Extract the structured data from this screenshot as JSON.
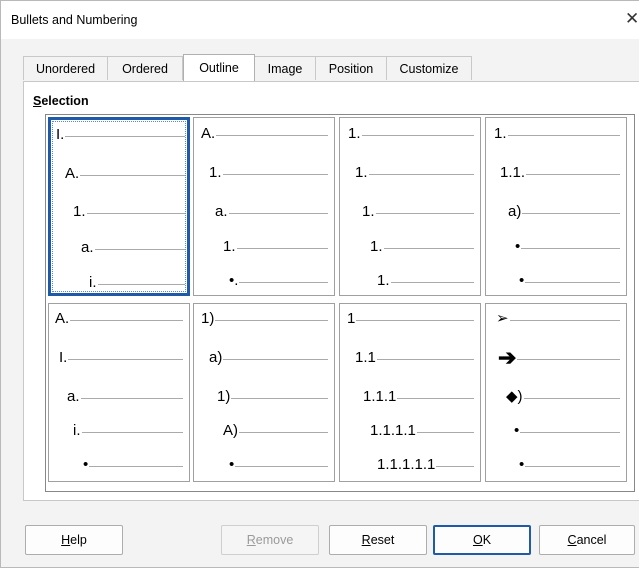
{
  "window": {
    "title": "Bullets and Numbering",
    "close_glyph": "✕"
  },
  "tabs": [
    {
      "label": "Unordered",
      "active": false
    },
    {
      "label": "Ordered",
      "active": false
    },
    {
      "label": "Outline",
      "active": true
    },
    {
      "label": "Image",
      "active": false
    },
    {
      "label": "Position",
      "active": false
    },
    {
      "label": "Customize",
      "active": false
    }
  ],
  "selection": {
    "title_access": "S",
    "title_rest": "election",
    "selected_index": 0,
    "cells": [
      {
        "levels": [
          "I.",
          "A.",
          "1.",
          "a.",
          "i."
        ]
      },
      {
        "levels": [
          "A.",
          "1.",
          "a.",
          "1.",
          "•."
        ]
      },
      {
        "levels": [
          "1.",
          "1.",
          "1.",
          "1.",
          "1."
        ]
      },
      {
        "levels": [
          "1.",
          "1.1.",
          "a)",
          "•",
          "•"
        ]
      },
      {
        "levels": [
          "A.",
          "I.",
          "a.",
          "i.",
          "•"
        ]
      },
      {
        "levels": [
          "1)",
          "a)",
          "1)",
          "A)",
          "•"
        ]
      },
      {
        "levels": [
          "1",
          "1.1",
          "1.1.1",
          "1.1.1.1",
          "1.1.1.1.1"
        ]
      },
      {
        "levels": [
          "➢",
          "➔",
          "◆)",
          "•",
          "•"
        ]
      }
    ]
  },
  "buttons": {
    "help": {
      "access": "H",
      "rest": "elp",
      "enabled": true
    },
    "remove": {
      "access": "R",
      "rest": "emove",
      "enabled": false
    },
    "reset": {
      "access": "R",
      "rest": "eset",
      "enabled": true
    },
    "ok": {
      "access": "O",
      "rest": "K",
      "enabled": true
    },
    "cancel": {
      "access": "C",
      "rest": "ancel",
      "enabled": true
    }
  },
  "colors": {
    "selection_border": "#1e5aa8",
    "preview_line": "#aaaaaa"
  }
}
